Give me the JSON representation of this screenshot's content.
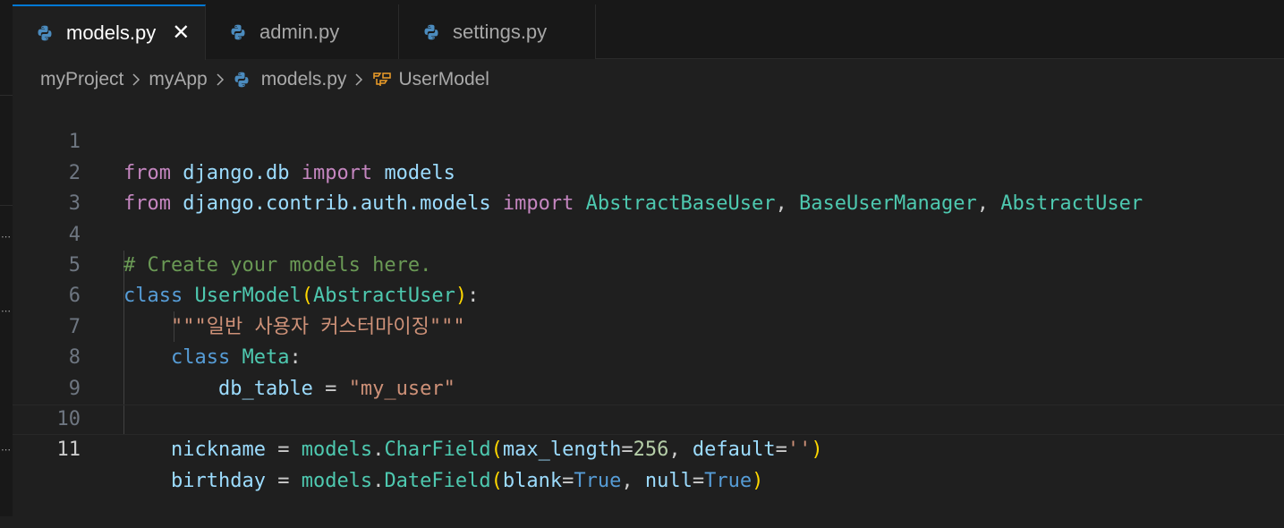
{
  "tabs": [
    {
      "label": "models.py",
      "active": true,
      "icon": "python-icon",
      "close": "✕"
    },
    {
      "label": "admin.py",
      "active": false,
      "icon": "python-icon"
    },
    {
      "label": "settings.py",
      "active": false,
      "icon": "python-icon"
    }
  ],
  "breadcrumb": {
    "project": "myProject",
    "app": "myApp",
    "file": "models.py",
    "symbol": "UserModel"
  },
  "editor": {
    "current_line": 11,
    "line_numbers": [
      "1",
      "2",
      "3",
      "4",
      "5",
      "6",
      "7",
      "8",
      "9",
      "10",
      "11"
    ],
    "code": {
      "l1": {
        "from": "from",
        "module": "django.db",
        "import": "import",
        "name": "models"
      },
      "l2": {
        "from": "from",
        "module": "django.contrib.auth.models",
        "import": "import",
        "n1": "AbstractBaseUser",
        "c1": ", ",
        "n2": "BaseUserManager",
        "c2": ", ",
        "n3": "AbstractUser"
      },
      "l4": {
        "comment": "# Create your models here."
      },
      "l5": {
        "class": "class",
        "name": "UserModel",
        "open": "(",
        "base": "AbstractUser",
        "close": ")",
        "colon": ":"
      },
      "l6": {
        "docstring": "\"\"\"일반 사용자 커스터마이징\"\"\""
      },
      "l7": {
        "class": "class",
        "name": "Meta",
        "colon": ":"
      },
      "l8": {
        "var": "db_table",
        "eq": " = ",
        "value": "\"my_user\""
      },
      "l10": {
        "var": "nickname",
        "eq": " = ",
        "obj": "models",
        "dot": ".",
        "call": "CharField",
        "open": "(",
        "p1": "max_length",
        "e1": "=",
        "v1": "256",
        "c1": ", ",
        "p2": "default",
        "e2": "=",
        "v2": "''",
        "close": ")"
      },
      "l11": {
        "var": "birthday",
        "eq": " = ",
        "obj": "models",
        "dot": ".",
        "call": "DateField",
        "open": "(",
        "p1": "blank",
        "e1": "=",
        "v1": "True",
        "c1": ", ",
        "p2": "null",
        "e2": "=",
        "v2": "True",
        "close": ")"
      }
    }
  },
  "colors": {
    "background": "#1f1f1f",
    "tab_active_border": "#0078d4",
    "keyword": "#c586c0",
    "type": "#4ec9b0",
    "comment": "#6a9955",
    "string": "#ce9178",
    "variable": "#9cdcfe"
  }
}
